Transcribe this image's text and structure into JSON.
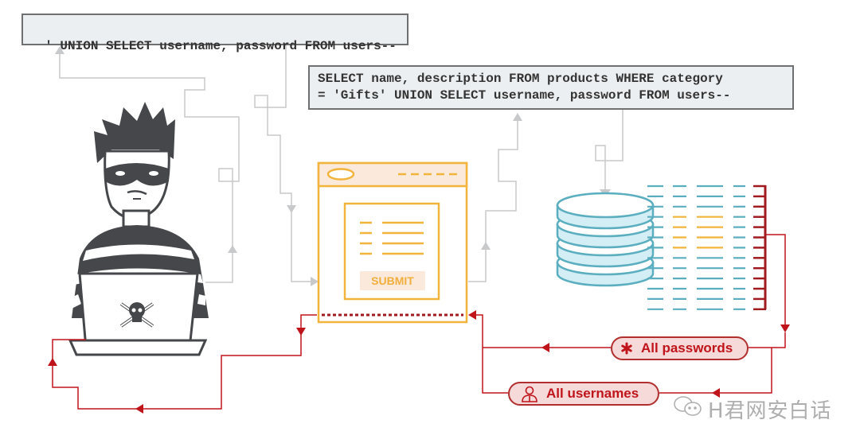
{
  "payload": {
    "text": "' UNION SELECT username, password FROM users--"
  },
  "query": {
    "line1": "SELECT name, description FROM products WHERE category",
    "line2": "= 'Gifts' UNION SELECT username, password FROM users--"
  },
  "web_form": {
    "submit_label": "SUBMIT"
  },
  "results": {
    "passwords_label": "All passwords",
    "passwords_icon": "asterisk-icon",
    "usernames_label": "All usernames",
    "usernames_icon": "user-icon"
  },
  "watermark": {
    "text": "H君网安白话",
    "icon": "wechat-icon"
  },
  "colors": {
    "attacker": "#45474a",
    "connector_gray": "#c8c9ca",
    "web_form": "#f2b43c",
    "database": "#5aaebf",
    "database_fill": "#d4eef5",
    "highlight": "#f2b43c",
    "result_red": "#c0141b"
  }
}
